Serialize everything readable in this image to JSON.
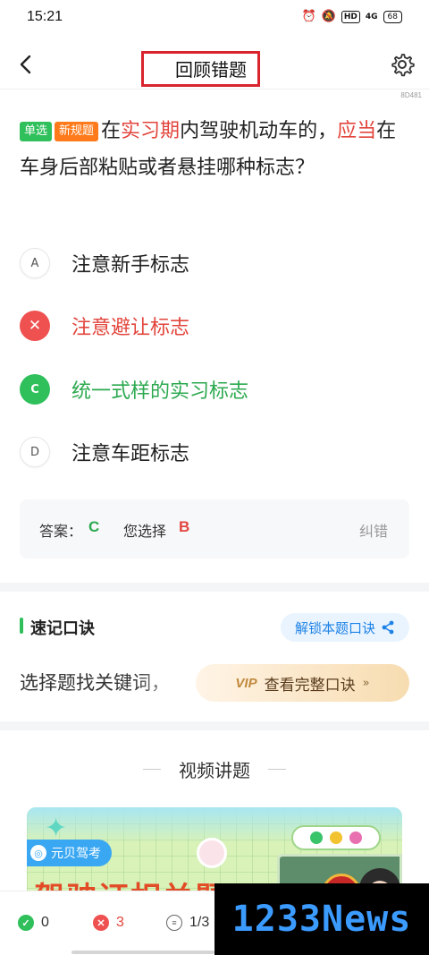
{
  "status": {
    "time": "15:21",
    "network": "4G",
    "hd": "HD",
    "battery": "68"
  },
  "nav": {
    "title": "回顾错题",
    "question_id": "8D481"
  },
  "question": {
    "tags": [
      "单选",
      "新规题"
    ],
    "text_parts": [
      "在",
      "实习期",
      "内驾驶机动车的，",
      "应当",
      "在车身后部粘贴或者悬挂哪种标志？"
    ],
    "options": [
      {
        "letter": "A",
        "text": "注意新手标志",
        "state": "normal"
      },
      {
        "letter": "✕",
        "text": "注意避让标志",
        "state": "wrong"
      },
      {
        "letter": "C",
        "text": "统一式样的实习标志",
        "state": "correct"
      },
      {
        "letter": "D",
        "text": "注意车距标志",
        "state": "normal"
      }
    ]
  },
  "answer": {
    "answer_label": "答案：",
    "answer_value": "C",
    "choice_label": "您选择",
    "choice_value": "B",
    "report_label": "纠错"
  },
  "mnemonic": {
    "title": "速记口诀",
    "unlock_label": "解锁本题口诀",
    "preview_text": "选择题找关键词，",
    "vip_badge": "VIP",
    "vip_label": "查看完整口诀",
    "vip_chevron": "»"
  },
  "video": {
    "heading": "视频讲题",
    "brand": "元贝驾考",
    "card_title": "驾驶证相关题"
  },
  "bottom_bar": {
    "correct_count": "0",
    "wrong_count": "3",
    "progress": "1/3"
  },
  "watermark": {
    "text": "1233News"
  },
  "colors": {
    "accent_green": "#2fbf5b",
    "accent_red": "#ef5050",
    "accent_blue": "#1e82e6",
    "tag_orange": "#ff7a1a"
  },
  "icons": {
    "back": "chevron-left-icon",
    "settings": "gear-icon",
    "share": "share-icon",
    "wrong": "x-circle-icon",
    "correct": "check-circle-icon",
    "list": "list-icon"
  }
}
